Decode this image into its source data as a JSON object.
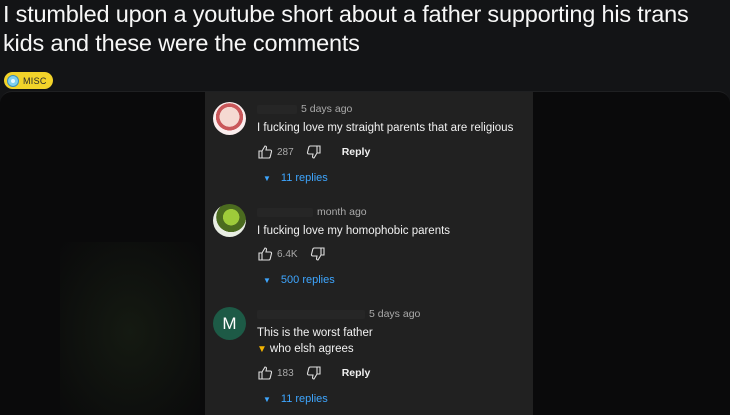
{
  "post": {
    "title": "I stumbled upon a youtube short about a father supporting his trans kids and these were the comments",
    "flair": "MISC"
  },
  "comments": [
    {
      "avatar_letter": "",
      "time": "5 days ago",
      "lines": [
        "I fucking love my straight parents that are religious"
      ],
      "likes": "287",
      "reply_label": "Reply",
      "replies_label": "11 replies"
    },
    {
      "avatar_letter": "",
      "time": "month ago",
      "lines": [
        "I fucking love my homophobic parents"
      ],
      "likes": "6.4K",
      "reply_label": "",
      "replies_label": "500 replies"
    },
    {
      "avatar_letter": "M",
      "time": "5 days ago",
      "lines": [
        "This is the worst father",
        "who elsh agrees"
      ],
      "emoji": "point-down-emoji",
      "likes": "183",
      "reply_label": "Reply",
      "replies_label": "11 replies"
    }
  ],
  "colors": {
    "background": "#131416",
    "panel": "#212121",
    "link": "#3ea6ff",
    "flair": "#f2d32a",
    "avatar_m": "#1d5a46"
  }
}
